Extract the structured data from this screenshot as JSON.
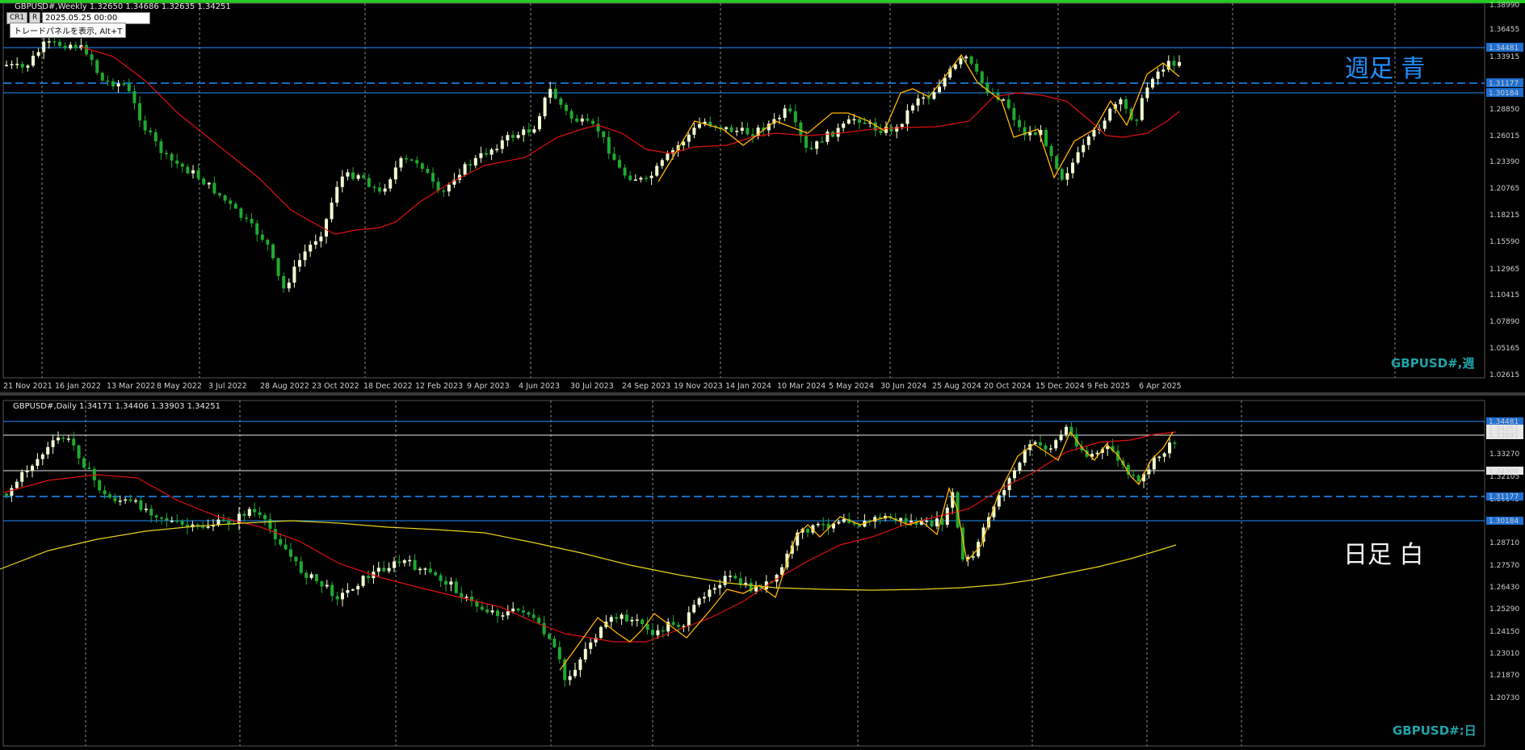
{
  "weekly": {
    "title": "GBPUSD#,Weekly  1.32650 1.34686 1.32635 1.34251",
    "watermark": "GBPUSD#,週",
    "annotation": "週足 青",
    "toolbar": {
      "cr_label": "CR1",
      "r_label": "R",
      "time_value": "2025.05.25 00:00"
    },
    "tooltip": "トレードパネルを表示, Alt+T",
    "price_labels": [
      "1.38990",
      "1.36455",
      "1.33915",
      "1.31385",
      "1.28850",
      "1.26015",
      "1.23390",
      "1.20765",
      "1.18215",
      "1.15590",
      "1.12965",
      "1.10415",
      "1.07890",
      "1.05165",
      "1.02615"
    ],
    "hline_labels": [
      "1.34481",
      "1.31177",
      "1.30184"
    ],
    "date_labels": [
      "21 Nov 2021",
      "16 Jan 2022",
      "13 Mar 2022",
      "8 May 2022",
      "3 Jul 2022",
      "28 Aug 2022",
      "23 Oct 2022",
      "18 Dec 2022",
      "12 Feb 2023",
      "9 Apr 2023",
      "4 Jun 2023",
      "30 Jul 2023",
      "24 Sep 2023",
      "19 Nov 2023",
      "14 Jan 2024",
      "10 Mar 2024",
      "5 May 2024",
      "30 Jun 2024",
      "25 Aug 2024",
      "20 Oct 2024",
      "15 Dec 2024",
      "9 Feb 2025",
      "6 Apr 2025"
    ],
    "colors": {
      "hline": "#1e90ff",
      "ma": "#e01010",
      "zigzag": "#ffb400",
      "bull": "#f0ffd0",
      "bear": "#1faa30",
      "top_bar": "#22cc22"
    }
  },
  "daily": {
    "title": "GBPUSD#,Daily  1.34171 1.34406 1.33903 1.34251",
    "watermark": "GBPUSD#:日",
    "annotation": "日足 白",
    "price_labels": [
      "1.33270",
      "1.32105",
      "1.30945",
      "1.29850",
      "1.28710",
      "1.27570",
      "1.26430",
      "1.25290",
      "1.24150",
      "1.23010",
      "1.21870",
      "1.20730"
    ],
    "hline_labels": [
      "1.34481",
      "1.34251",
      "1.33891",
      "1.32308",
      "1.31177",
      "1.30184"
    ],
    "colors": {
      "hline_blue": "#1e90ff",
      "hline_white": "#e8e8e8",
      "ma_red": "#e01010",
      "ma_yellow": "#e6d21e",
      "zigzag": "#ffb400"
    }
  }
}
